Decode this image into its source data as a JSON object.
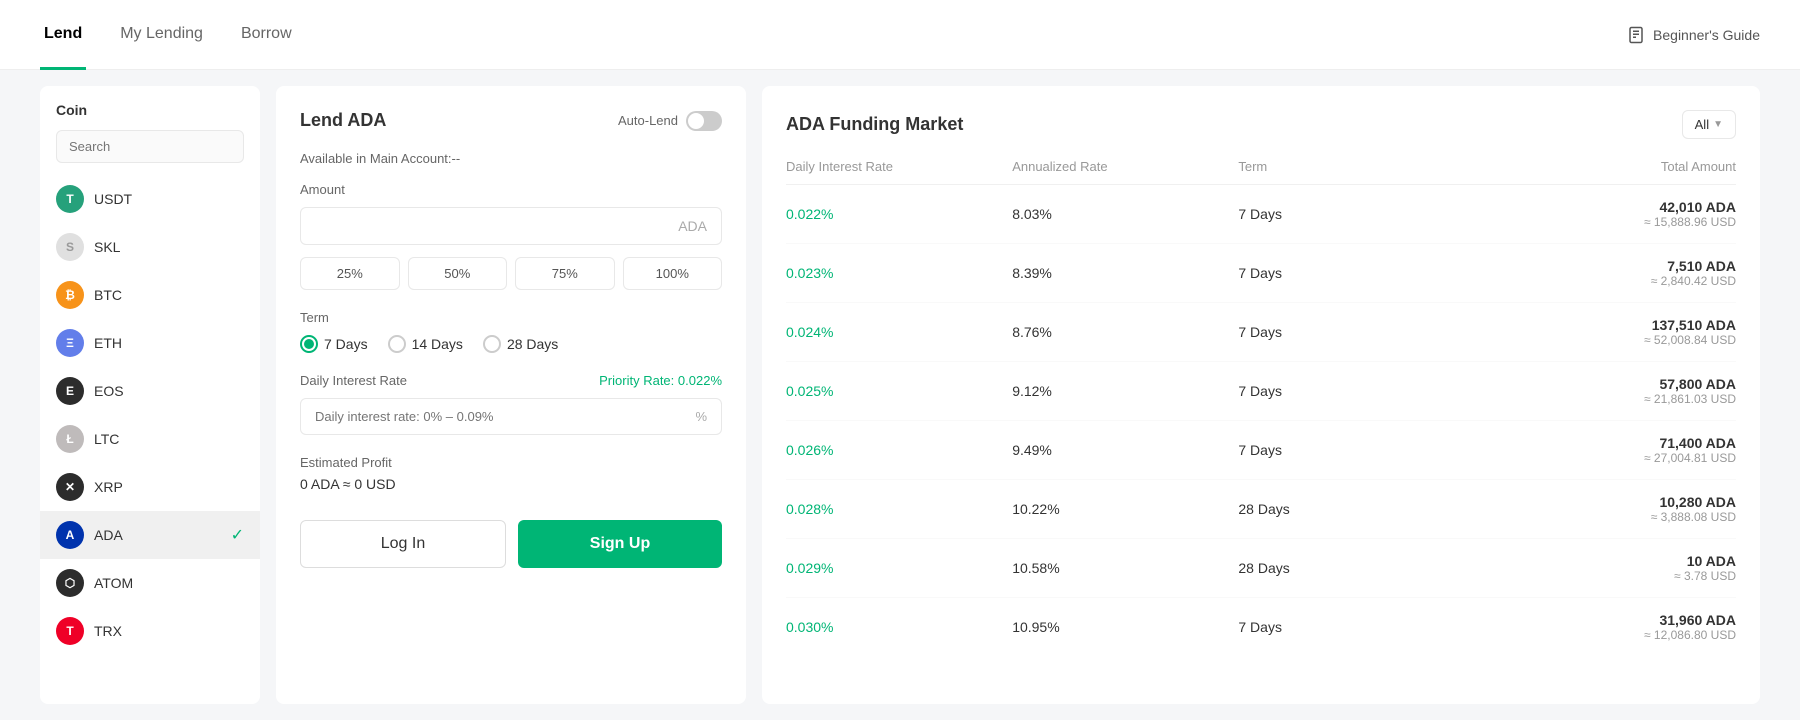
{
  "nav": {
    "tabs": [
      {
        "label": "Lend",
        "active": true
      },
      {
        "label": "My Lending",
        "active": false
      },
      {
        "label": "Borrow",
        "active": false
      }
    ],
    "guide_label": "Beginner's Guide"
  },
  "coin_panel": {
    "header": "Coin",
    "search_placeholder": "Search",
    "coins": [
      {
        "symbol": "USDT",
        "color": "#26a17b",
        "text_color": "#fff",
        "letter": "T",
        "active": false
      },
      {
        "symbol": "SKL",
        "color": "#e0e0e0",
        "text_color": "#999",
        "letter": "S",
        "active": false
      },
      {
        "symbol": "BTC",
        "color": "#f7931a",
        "text_color": "#fff",
        "letter": "₿",
        "active": false
      },
      {
        "symbol": "ETH",
        "color": "#627eea",
        "text_color": "#fff",
        "letter": "Ξ",
        "active": false
      },
      {
        "symbol": "EOS",
        "color": "#2c2c2c",
        "text_color": "#fff",
        "letter": "E",
        "active": false
      },
      {
        "symbol": "LTC",
        "color": "#bfbbbb",
        "text_color": "#fff",
        "letter": "Ł",
        "active": false
      },
      {
        "symbol": "XRP",
        "color": "#2c2c2c",
        "text_color": "#fff",
        "letter": "✕",
        "active": false
      },
      {
        "symbol": "ADA",
        "color": "#0033ad",
        "text_color": "#fff",
        "letter": "A",
        "active": true
      },
      {
        "symbol": "ATOM",
        "color": "#2c2c2c",
        "text_color": "#fff",
        "letter": "⬡",
        "active": false
      },
      {
        "symbol": "TRX",
        "color": "#ef0027",
        "text_color": "#fff",
        "letter": "T",
        "active": false
      }
    ]
  },
  "lend_panel": {
    "title": "Lend ADA",
    "auto_lend_label": "Auto-Lend",
    "available_text": "Available in Main Account:--",
    "amount_label": "Amount",
    "amount_placeholder": "",
    "amount_currency": "ADA",
    "percent_buttons": [
      "25%",
      "50%",
      "75%",
      "100%"
    ],
    "term_label": "Term",
    "term_options": [
      {
        "label": "7 Days",
        "checked": true
      },
      {
        "label": "14 Days",
        "checked": false
      },
      {
        "label": "28 Days",
        "checked": false
      }
    ],
    "interest_label": "Daily Interest Rate",
    "priority_rate_label": "Priority Rate:",
    "priority_rate_value": "0.022%",
    "interest_placeholder": "Daily interest rate: 0% – 0.09%",
    "interest_unit": "%",
    "profit_label": "Estimated Profit",
    "profit_value": "0 ADA ≈ 0 USD",
    "login_button": "Log In",
    "signup_button": "Sign Up"
  },
  "market_panel": {
    "title": "ADA Funding Market",
    "filter_label": "All",
    "columns": [
      "Daily Interest Rate",
      "Annualized Rate",
      "Term",
      "Total Amount"
    ],
    "rows": [
      {
        "daily_rate": "0.022%",
        "annualized": "8.03%",
        "term": "7 Days",
        "amount": "42,010 ADA",
        "usd": "≈ 15,888.96 USD"
      },
      {
        "daily_rate": "0.023%",
        "annualized": "8.39%",
        "term": "7 Days",
        "amount": "7,510 ADA",
        "usd": "≈ 2,840.42 USD"
      },
      {
        "daily_rate": "0.024%",
        "annualized": "8.76%",
        "term": "7 Days",
        "amount": "137,510 ADA",
        "usd": "≈ 52,008.84 USD"
      },
      {
        "daily_rate": "0.025%",
        "annualized": "9.12%",
        "term": "7 Days",
        "amount": "57,800 ADA",
        "usd": "≈ 21,861.03 USD"
      },
      {
        "daily_rate": "0.026%",
        "annualized": "9.49%",
        "term": "7 Days",
        "amount": "71,400 ADA",
        "usd": "≈ 27,004.81 USD"
      },
      {
        "daily_rate": "0.028%",
        "annualized": "10.22%",
        "term": "28 Days",
        "amount": "10,280 ADA",
        "usd": "≈ 3,888.08 USD"
      },
      {
        "daily_rate": "0.029%",
        "annualized": "10.58%",
        "term": "28 Days",
        "amount": "10 ADA",
        "usd": "≈ 3.78 USD"
      },
      {
        "daily_rate": "0.030%",
        "annualized": "10.95%",
        "term": "7 Days",
        "amount": "31,960 ADA",
        "usd": "≈ 12,086.80 USD"
      }
    ]
  }
}
